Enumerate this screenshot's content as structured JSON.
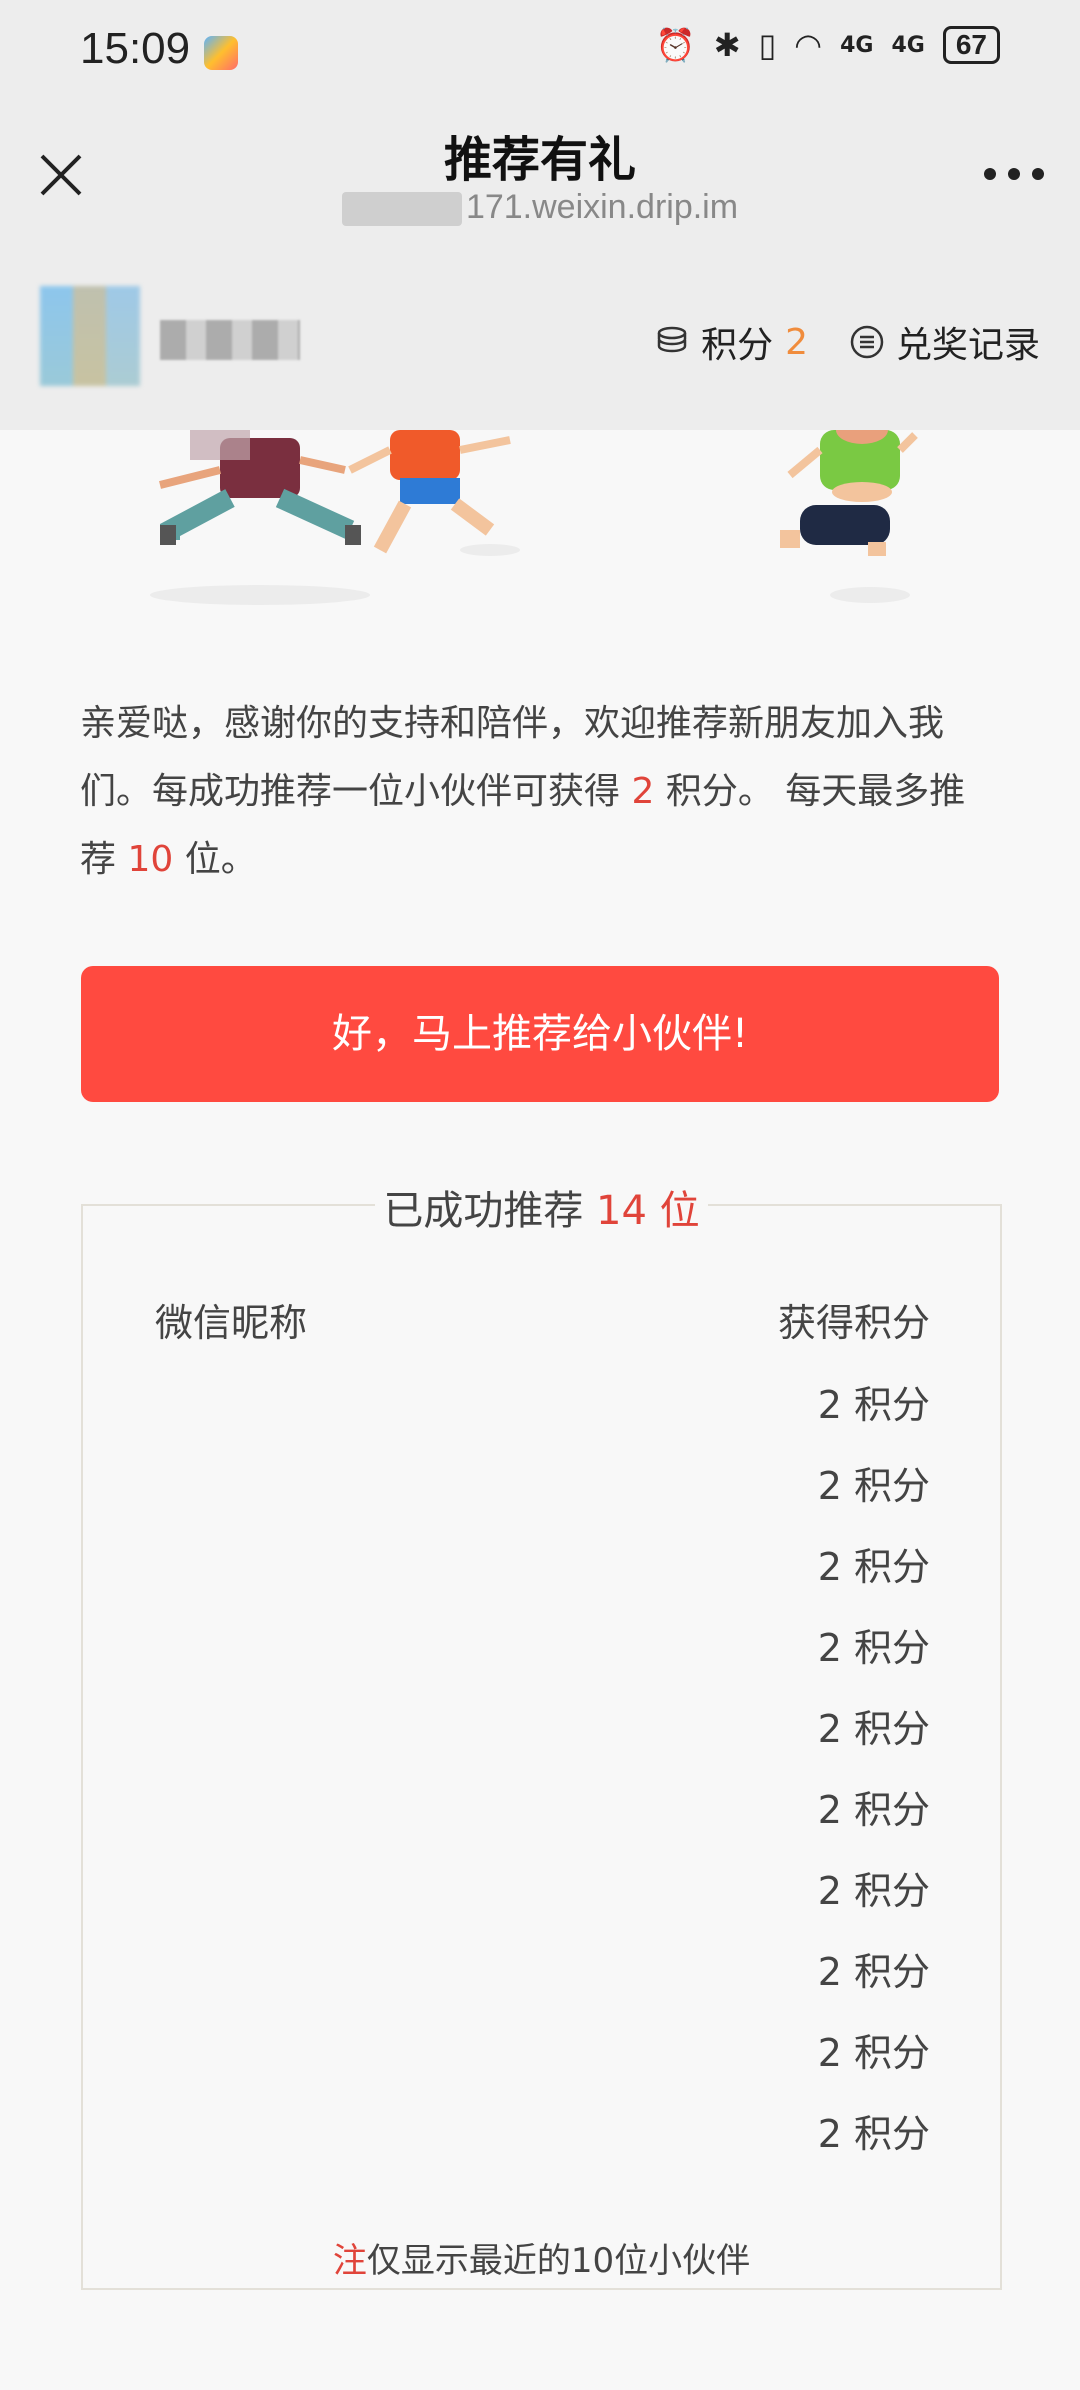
{
  "status": {
    "time": "15:09",
    "battery": "67",
    "signal1": "4G",
    "signal2": "4G"
  },
  "nav": {
    "title": "推荐有礼",
    "url_suffix": "171.weixin.drip.im"
  },
  "user": {
    "points_label": "积分",
    "points_value": "2",
    "records_label": "兑奖记录"
  },
  "intro": {
    "part1": "亲爱哒，感谢你的支持和陪伴，欢迎推荐新朋友加入我们。每成功推荐一位小伙伴可获得",
    "points_per_referral": "2",
    "part2": "积分。 每天最多推荐",
    "daily_max": "10",
    "part3": "位。"
  },
  "cta": {
    "label": "好，马上推荐给小伙伴!"
  },
  "panel": {
    "title_prefix": "已成功推荐",
    "count": "14 位",
    "col_nickname": "微信昵称",
    "col_points": "获得积分",
    "rows": [
      {
        "points": "2 积分"
      },
      {
        "points": "2 积分"
      },
      {
        "points": "2 积分"
      },
      {
        "points": "2 积分"
      },
      {
        "points": "2 积分"
      },
      {
        "points": "2 积分"
      },
      {
        "points": "2 积分"
      },
      {
        "points": "2 积分"
      },
      {
        "points": "2 积分"
      },
      {
        "points": "2 积分"
      }
    ],
    "note_mark": "注",
    "note_text": "仅显示最近的10位小伙伴"
  },
  "colors": {
    "accent_red": "#ff4a40",
    "highlight_red": "#e0443a",
    "points_orange": "#f08c3c"
  }
}
